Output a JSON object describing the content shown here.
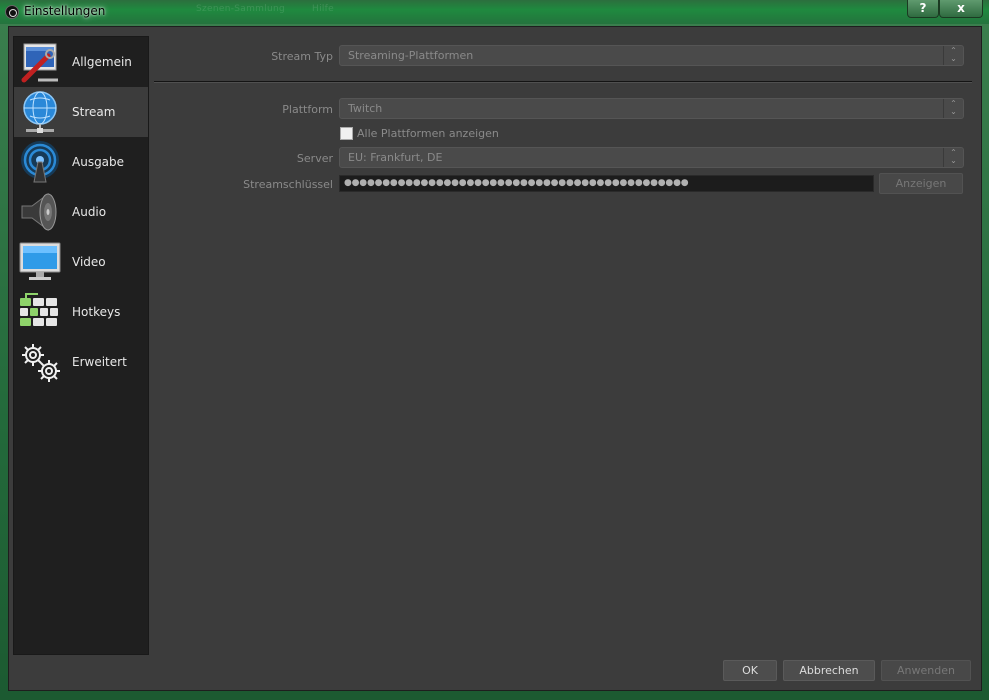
{
  "window": {
    "title": "Einstellungen",
    "help_label": "?",
    "close_label": "x",
    "background_ghost": [
      "Szenen-Sammlung",
      "Hilfe"
    ]
  },
  "sidebar": {
    "items": [
      {
        "label": "Allgemein",
        "icon": "settings-wrench-icon",
        "active": false
      },
      {
        "label": "Stream",
        "icon": "globe-network-icon",
        "active": true
      },
      {
        "label": "Ausgabe",
        "icon": "broadcast-antenna-icon",
        "active": false
      },
      {
        "label": "Audio",
        "icon": "speaker-icon",
        "active": false
      },
      {
        "label": "Video",
        "icon": "monitor-icon",
        "active": false
      },
      {
        "label": "Hotkeys",
        "icon": "keyboard-icon",
        "active": false
      },
      {
        "label": "Erweitert",
        "icon": "gears-icon",
        "active": false
      }
    ]
  },
  "stream": {
    "stream_type_label": "Stream Typ",
    "stream_type_value": "Streaming-Plattformen",
    "platform_label": "Plattform",
    "platform_value": "Twitch",
    "show_all_label": "Alle Plattformen anzeigen",
    "show_all_checked": false,
    "server_label": "Server",
    "server_value": "EU: Frankfurt, DE",
    "key_label": "Streamschlüssel",
    "key_value": "●●●●●●●●●●●●●●●●●●●●●●●●●●●●●●●●●●●●●●●●●●●●●",
    "show_button": "Anzeigen"
  },
  "footer": {
    "ok": "OK",
    "cancel": "Abbrechen",
    "apply": "Anwenden"
  },
  "colors": {
    "accent_frame": "#2a6e3c",
    "panel": "#3c3c3c",
    "sidebar": "#1f1f1f"
  }
}
